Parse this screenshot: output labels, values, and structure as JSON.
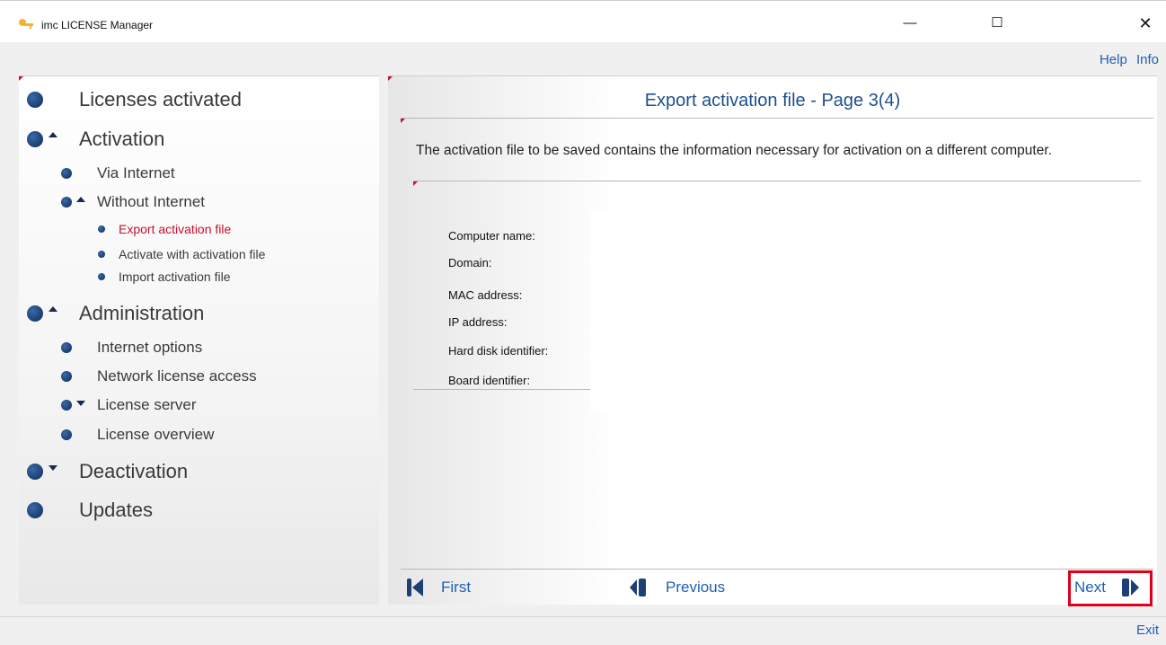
{
  "window": {
    "title": "imc LICENSE Manager",
    "minimize": "—",
    "maximize": "☐",
    "close": "✕"
  },
  "toplinks": {
    "help": "Help",
    "info": "Info"
  },
  "sidebar": {
    "licenses_activated": "Licenses activated",
    "activation": "Activation",
    "via_internet": "Via Internet",
    "without_internet": "Without Internet",
    "export_activation_file": "Export activation file",
    "activate_with_activation_file": "Activate with activation file",
    "import_activation_file": "Import activation file",
    "administration": "Administration",
    "internet_options": "Internet options",
    "network_license_access": "Network license access",
    "license_server": "License server",
    "license_overview": "License overview",
    "deactivation": "Deactivation",
    "updates": "Updates"
  },
  "main": {
    "title": "Export activation file - Page 3(4)",
    "description": "The activation file to be saved contains the information necessary for activation on a different computer.",
    "fields": {
      "computer_name": "Computer name:",
      "domain": "Domain:",
      "mac_address": "MAC address:",
      "ip_address": "IP address:",
      "hard_disk_identifier": "Hard disk identifier:",
      "board_identifier": "Board identifier:"
    }
  },
  "navigation": {
    "first": "First",
    "previous": "Previous",
    "next": "Next"
  },
  "footer": {
    "exit": "Exit"
  },
  "colors": {
    "accent": "#1e5fb4",
    "active": "#c8102e",
    "highlight": "#e0001a"
  }
}
